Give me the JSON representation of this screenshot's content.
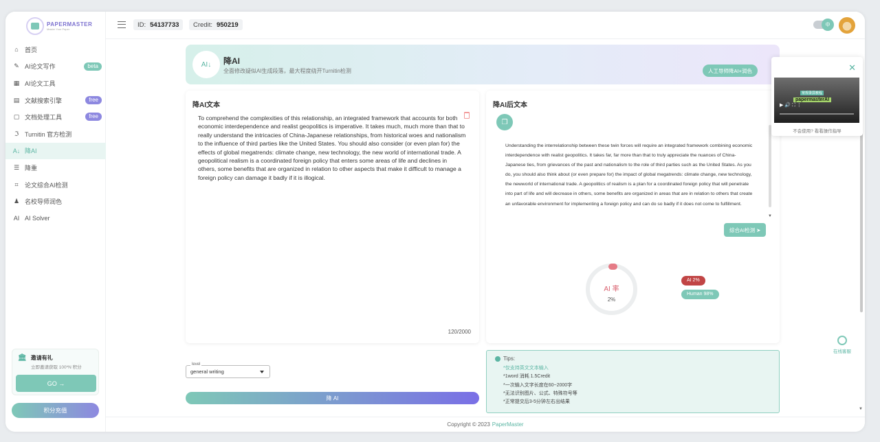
{
  "brand": {
    "name": "PAPERMASTER",
    "tagline": "Master Your Paper"
  },
  "sidebar": {
    "items": [
      {
        "label": "首页",
        "icon": "home-icon",
        "glyph": "⌂"
      },
      {
        "label": "AI论文写作",
        "icon": "edit-icon",
        "glyph": "✎",
        "badge": "beta"
      },
      {
        "label": "AI论文工具",
        "icon": "tools-icon",
        "glyph": "▦"
      },
      {
        "label": "文献搜索引擎",
        "icon": "book-icon",
        "glyph": "▤",
        "badge": "free"
      },
      {
        "label": "文档处理工具",
        "icon": "document-icon",
        "glyph": "▢",
        "badge": "free"
      },
      {
        "label": "Turnitin 官方检测",
        "icon": "turnitin-icon",
        "glyph": "ℑ"
      },
      {
        "label": "降AI",
        "icon": "reduce-ai-icon",
        "glyph": "A↓",
        "active": true
      },
      {
        "label": "降重",
        "icon": "reduce-dup-icon",
        "glyph": "☰"
      },
      {
        "label": "论文综合AI检测",
        "icon": "scan-icon",
        "glyph": "⌗"
      },
      {
        "label": "名校导师润色",
        "icon": "mentor-icon",
        "glyph": "♟"
      },
      {
        "label": "AI Solver",
        "icon": "ai-solver-icon",
        "glyph": "AI"
      }
    ],
    "invite": {
      "title": "邀请有礼",
      "subtitle": "立即邀请获取 100*N 积分",
      "go": "GO →"
    },
    "recharge": "积分充值"
  },
  "header": {
    "id_label": "ID:",
    "id_value": "54137733",
    "credit_label": "Credit:",
    "credit_value": "950219",
    "lang": "中"
  },
  "banner": {
    "icon_text": "AI↓",
    "title": "降AI",
    "subtitle": "全面修改疑似AI生成段落，最大程度绕开Turnitin检测",
    "button": "人工导师降AI+润色"
  },
  "input_panel": {
    "title": "降AI文本",
    "text": "To comprehend the complexities of this relationship, an integrated framework that accounts for both economic interdependence and realist geopolitics  is imperative. It takes much, much more than that to really understand the intricacies  of China-Japanese relationships, from historical woes and nationalism to the influence of third parties like the United States. You should also consider (or even plan for) the effects of global megatrends: climate change, new technology, the new  world of international trade. A geopolitical realism is a coordinated foreign policy that enters some areas of life and declines in others, some benefits that are organized in relation to other aspects that make it difficult to  manage a foreign policy can damage it badly if it is illogical.",
    "count": "120/2000"
  },
  "output_panel": {
    "title": "降AI后文本",
    "text": "Understanding the interrelationship between these  twin forces will require an integrated framework combining economic interdependence with realist geopolitics. It takes far, far more than that to truly appreciate the nuances of China-Japanese ties, from grievances  of the past and nationalism to the role of third parties such as the United States. As you do, you should also think about (or even prepare for) the impact of global megatrends: climate change, new technology, the newworld of international  trade. A geopolitics of realism is a plan for a coordinated foreign policy that will penetrate into part of life and will decrease in others, some benefits are organized in areas that are in  relation to others that create an unfavorable environment for implementing a foreign policy and can do so badly if it does not come to fulfillment.",
    "detect_button": "综合AI检测 ➤",
    "gauge_label": "AI 率",
    "ai_rate": "2%",
    "ai_rate_value": 2,
    "ai_pill": "AI 2%",
    "human_pill": "Human 98%"
  },
  "controls": {
    "level_label": "level",
    "level_value": "general writing",
    "submit": "降 AI"
  },
  "tips": {
    "title": "Tips:",
    "items": [
      "*仅支持英文文本输入",
      "*1word 消耗 1.5Credit",
      "*一次输入文字长度在60~2000字",
      "*无法识别图片、公式、特殊符号等",
      "*正常提交后3-5分钟左右出结果"
    ]
  },
  "footer": {
    "copyright": "Copyright © 2023",
    "brand": "PaperMaster"
  },
  "service": {
    "label": "在线客服"
  },
  "video": {
    "top_label": "常规录屏教程",
    "label": "papermasterAI",
    "controls": "▶   🔊   ⛶  ⋮",
    "hint": "不会使用? 看看操作指导",
    "close": "✕"
  },
  "colors": {
    "accent": "#7ec8b7",
    "accent_dark": "#5bb5a3",
    "purple": "#8d88e0",
    "ai_red": "#c14545"
  }
}
